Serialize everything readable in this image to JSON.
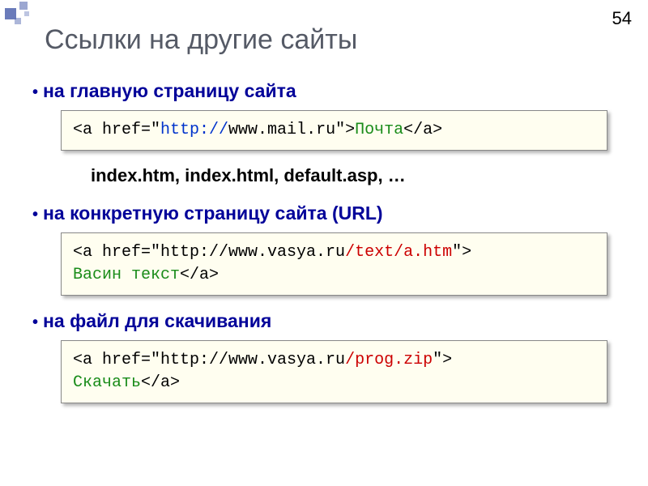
{
  "page_number": "54",
  "title": "Ссылки на другие сайты",
  "sections": {
    "s1": {
      "heading": "на главную страницу сайта",
      "code": {
        "p1": "<a href=\"",
        "p2": "http://",
        "p3": "www.mail.ru\">",
        "p4": "Почта",
        "p5": "</a>"
      },
      "note": "index.htm, index.html, default.asp, …"
    },
    "s2": {
      "heading": "на конкретную страницу сайта (URL)",
      "code": {
        "p1": "<a href=\"http://www.vasya.ru",
        "p2": "/text/a.htm",
        "p3": "\">",
        "p4": "Васин текст",
        "p5": "</a>"
      }
    },
    "s3": {
      "heading": "на файл для скачивания",
      "code": {
        "p1": "<a href=\"http://www.vasya.ru",
        "p2": "/prog.zip",
        "p3": "\">",
        "p4": "Скачать",
        "p5": "</a>"
      }
    }
  }
}
